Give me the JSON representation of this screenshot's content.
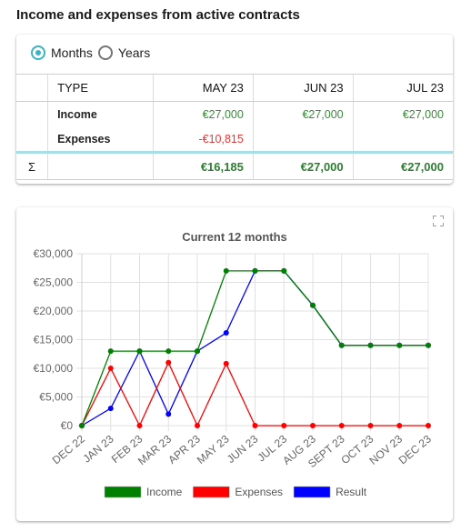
{
  "page": {
    "title": "Income and expenses from active contracts"
  },
  "period_toggle": {
    "options": [
      {
        "label": "Months",
        "selected": true
      },
      {
        "label": "Years",
        "selected": false
      }
    ]
  },
  "summary_table": {
    "sigma_symbol": "Σ",
    "headers": [
      "TYPE",
      "MAY 23",
      "JUN 23",
      "JUL 23"
    ],
    "rows": [
      {
        "type": "Income",
        "values": [
          "€27,000",
          "€27,000",
          "€27,000"
        ]
      },
      {
        "type": "Expenses",
        "values": [
          "-€10,815",
          "",
          ""
        ]
      }
    ],
    "totals": [
      "€16,185",
      "€27,000",
      "€27,000"
    ]
  },
  "chart_panel": {
    "expand_icon": "fullscreen-icon"
  },
  "chart_data": {
    "type": "line",
    "title": "Current 12 months",
    "xlabel": "",
    "ylabel": "",
    "categories": [
      "DEC 22",
      "JAN 23",
      "FEB 23",
      "MAR 23",
      "APR 23",
      "MAY 23",
      "JUN 23",
      "JUL 23",
      "AUG 23",
      "SEPT 23",
      "OCT 23",
      "NOV 23",
      "DEC 23"
    ],
    "ylim": [
      0,
      30000
    ],
    "yticks": [
      0,
      5000,
      10000,
      15000,
      20000,
      25000,
      30000
    ],
    "ytick_labels": [
      "€0",
      "€5,000",
      "€10,000",
      "€15,000",
      "€20,000",
      "€25,000",
      "€30,000"
    ],
    "grid": true,
    "legend_position": "bottom",
    "series": [
      {
        "name": "Income",
        "color": "#008000",
        "values": [
          0,
          13000,
          13000,
          13000,
          13000,
          27000,
          27000,
          27000,
          21000,
          14000,
          14000,
          14000,
          14000
        ]
      },
      {
        "name": "Expenses",
        "color": "#ff0000",
        "values": [
          0,
          10000,
          0,
          11000,
          0,
          10815,
          0,
          0,
          0,
          0,
          0,
          0,
          0
        ]
      },
      {
        "name": "Result",
        "color": "#0000ff",
        "values": [
          0,
          3000,
          13000,
          2000,
          13000,
          16185,
          27000,
          27000,
          21000,
          14000,
          14000,
          14000,
          14000
        ]
      }
    ]
  }
}
